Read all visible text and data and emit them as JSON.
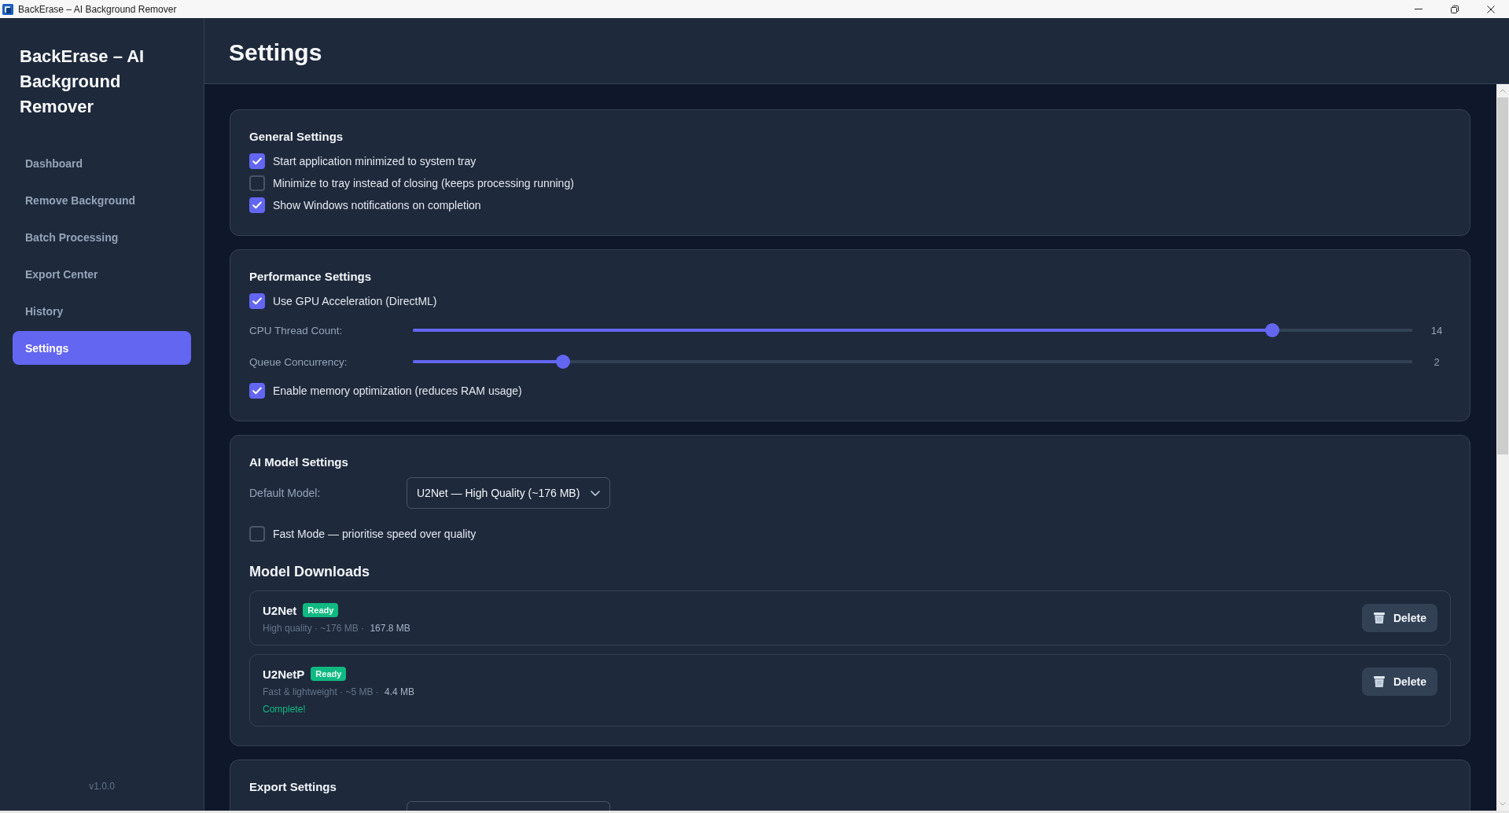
{
  "window": {
    "title": "BackErase – AI Background Remover"
  },
  "sidebar": {
    "brand": "BackErase – AI Background Remover",
    "items": [
      {
        "label": "Dashboard",
        "selected": false
      },
      {
        "label": "Remove Background",
        "selected": false
      },
      {
        "label": "Batch Processing",
        "selected": false
      },
      {
        "label": "Export Center",
        "selected": false
      },
      {
        "label": "History",
        "selected": false
      },
      {
        "label": "Settings",
        "selected": true
      }
    ],
    "version": "v1.0.0"
  },
  "page": {
    "title": "Settings"
  },
  "sections": [
    {
      "title": "General Settings",
      "rows": [
        {
          "kind": "checkbox",
          "label": "Start application minimized to system tray",
          "checked": true
        },
        {
          "kind": "checkbox",
          "label": "Minimize to tray instead of closing (keeps processing running)",
          "checked": false
        },
        {
          "kind": "checkbox",
          "label": "Show Windows notifications on completion",
          "checked": true
        }
      ]
    },
    {
      "title": "Performance Settings",
      "rows": [
        {
          "kind": "checkbox",
          "label": "Use GPU Acceleration (DirectML)",
          "checked": true
        },
        {
          "kind": "slider",
          "label": "CPU Thread Count:",
          "level": 0.86,
          "reading": "14"
        },
        {
          "kind": "slider",
          "label": "Queue Concurrency:",
          "level": 0.15,
          "reading": "2"
        },
        {
          "kind": "checkbox",
          "label": "Enable memory optimization (reduces RAM usage)",
          "checked": true
        }
      ]
    },
    {
      "title": "AI Model Settings",
      "rows": [
        {
          "kind": "select",
          "label": "Default Model:",
          "value": "U2Net — High Quality (~176 MB)"
        },
        {
          "kind": "checkbox",
          "label": "Fast Mode — prioritise speed over quality",
          "checked": false
        },
        {
          "kind": "heading",
          "text": "Model Downloads"
        },
        {
          "kind": "model",
          "name": "U2Net",
          "status": "Ready",
          "info": "High quality · ~176 MB ·",
          "size": "167.8 MB",
          "action": "Delete"
        },
        {
          "kind": "model",
          "name": "U2NetP",
          "status": "Ready",
          "info": "Fast & lightweight · ~5 MB ·",
          "size": "4.4 MB",
          "message": "Complete!",
          "action": "Delete"
        }
      ]
    },
    {
      "title": "Export Settings",
      "rows": [
        {
          "kind": "select"
        }
      ]
    }
  ]
}
